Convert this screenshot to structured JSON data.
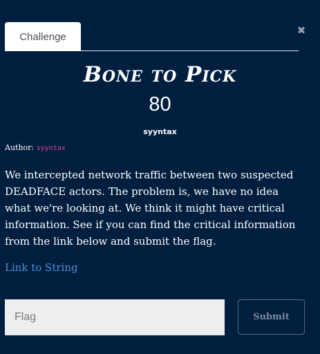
{
  "tabs": [
    {
      "label": "Challenge"
    }
  ],
  "close_symbol": "✖",
  "challenge": {
    "title": "Bone to Pick",
    "points": "80",
    "tag": "syyntax",
    "author_label": "Author: ",
    "author_name": "syyntax",
    "description": "We intercepted network traffic between two suspected DEADFACE actors. The problem is, we have no idea what we're looking at. We think it might have critical information. See if you can find the critical information from the link below and submit the flag.",
    "link_text": "Link to String"
  },
  "form": {
    "flag_placeholder": "Flag",
    "submit_label": "Submit"
  },
  "icons": {
    "close": "close-icon"
  },
  "colors": {
    "background": "#001f3f",
    "author_accent": "#e83e8c",
    "link": "#4a8fd8"
  }
}
